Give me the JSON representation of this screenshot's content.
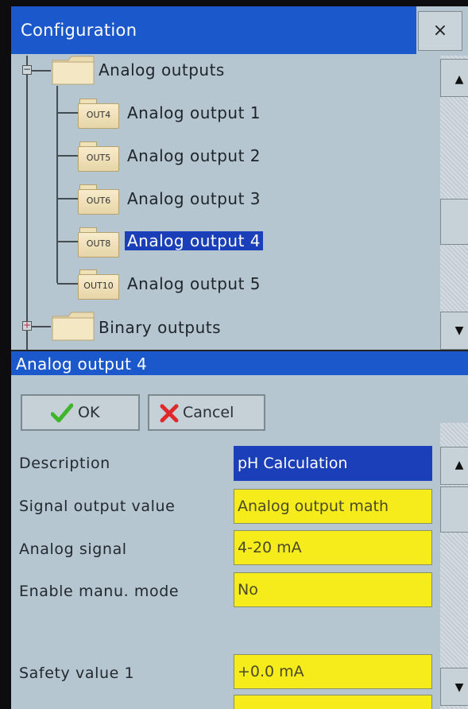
{
  "config_window": {
    "title": "Configuration",
    "close_glyph": "×",
    "tree": {
      "analog_outputs": {
        "label": "Analog outputs",
        "expander": "−"
      },
      "children": [
        {
          "icon_text": "OUT4",
          "label": "Analog output 1",
          "selected": false
        },
        {
          "icon_text": "OUT5",
          "label": "Analog output 2",
          "selected": false
        },
        {
          "icon_text": "OUT6",
          "label": "Analog output 3",
          "selected": false
        },
        {
          "icon_text": "OUT8",
          "label": "Analog output 4",
          "selected": true
        },
        {
          "icon_text": "OUT10",
          "label": "Analog output 5",
          "selected": false
        }
      ],
      "binary_outputs": {
        "label": "Binary outputs",
        "expander": "+"
      }
    },
    "scroll_up_glyph": "▲",
    "scroll_down_glyph": "▼"
  },
  "dialog": {
    "title": "Analog output 4",
    "ok_label": "OK",
    "cancel_label": "Cancel",
    "fields": [
      {
        "label": "Description",
        "value": "pH Calculation"
      },
      {
        "label": "Signal output value",
        "value": "Analog output math"
      },
      {
        "label": "Analog signal",
        "value": "4-20 mA"
      },
      {
        "label": "Enable manu. mode",
        "value": "No"
      },
      {
        "label": "Safety value 1",
        "value": "+0.0 mA"
      }
    ],
    "scroll_up_glyph": "▲",
    "scroll_down_glyph": "▼"
  },
  "colors": {
    "title_bar": "#1a58cc",
    "selection": "#1a3fb8",
    "field_yellow": "#f6ec1c",
    "panel_bg": "#b6c6d0"
  }
}
